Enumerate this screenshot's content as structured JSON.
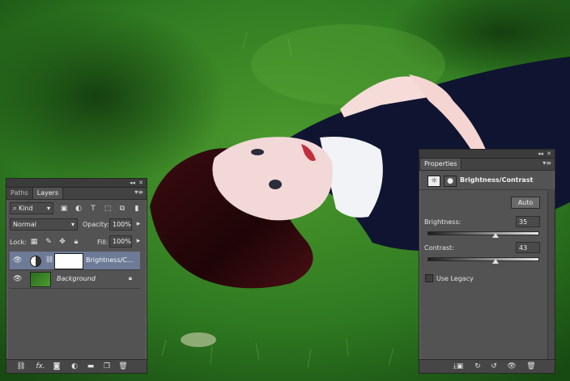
{
  "layers_panel": {
    "tabs": [
      "Paths",
      "Layers"
    ],
    "filter_kind": "Kind",
    "blend_mode": "Normal",
    "opacity_label": "Opacity:",
    "opacity_value": "100%",
    "lock_label": "Lock:",
    "fill_label": "Fill:",
    "fill_value": "100%",
    "layers": [
      {
        "name": "Brightness/C...",
        "selected": true
      },
      {
        "name": "Background",
        "selected": false
      }
    ],
    "bottom_icons": [
      "link-icon",
      "fx-icon",
      "mask-icon",
      "adjustment-icon",
      "group-icon",
      "new-layer-icon",
      "trash-icon"
    ],
    "fx_label": "fx."
  },
  "properties_panel": {
    "title": "Properties",
    "adjustment_name": "Brightness/Contrast",
    "auto_button": "Auto",
    "brightness_label": "Brightness:",
    "brightness_value": "35",
    "brightness_level": 35,
    "contrast_label": "Contrast:",
    "contrast_value": "43",
    "contrast_level": 43,
    "use_legacy_label": "Use Legacy",
    "use_legacy_checked": false
  },
  "colors": {
    "panel_bg": "#535353",
    "selected_row": "#6d7b97",
    "grass": "#2e6b22"
  }
}
